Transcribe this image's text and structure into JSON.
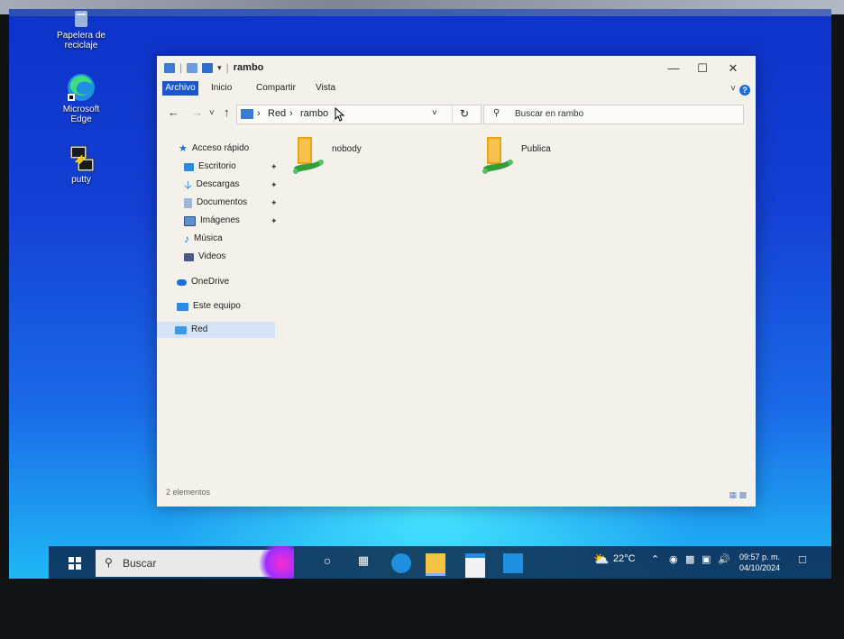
{
  "desktop": {
    "icons": [
      {
        "label": "Papelera de reciclaje"
      },
      {
        "label": "Microsoft Edge"
      },
      {
        "label": "putty"
      }
    ]
  },
  "window": {
    "title": "rambo",
    "controls": {
      "minimize": "—",
      "maximize": "☐",
      "close": "✕"
    },
    "ribbon": {
      "tabs": [
        "Archivo",
        "Inicio",
        "Compartir",
        "Vista"
      ],
      "help": "?"
    },
    "nav": {
      "back": "←",
      "forward": "→",
      "recent": "˅",
      "up": "↑",
      "refresh": "↻",
      "dropdown": "˅"
    },
    "address": {
      "segments": [
        "Red",
        "rambo"
      ],
      "separator": "›"
    },
    "search": {
      "placeholder": "Buscar en rambo"
    },
    "sidebar": {
      "quick_access": "Acceso rápido",
      "items": [
        {
          "label": "Escritorio",
          "pinned": true
        },
        {
          "label": "Descargas",
          "pinned": true
        },
        {
          "label": "Documentos",
          "pinned": true
        },
        {
          "label": "Imágenes",
          "pinned": true
        },
        {
          "label": "Música",
          "pinned": false
        },
        {
          "label": "Videos",
          "pinned": false
        }
      ],
      "onedrive": "OneDrive",
      "this_pc": "Este equipo",
      "network": "Red"
    },
    "content": {
      "items": [
        {
          "name": "nobody"
        },
        {
          "name": "Publica"
        }
      ]
    },
    "status": "2 elementos"
  },
  "taskbar": {
    "search": "Buscar",
    "weather": "22°C",
    "time": "09:57 p. m.",
    "date": "04/10/2024"
  }
}
